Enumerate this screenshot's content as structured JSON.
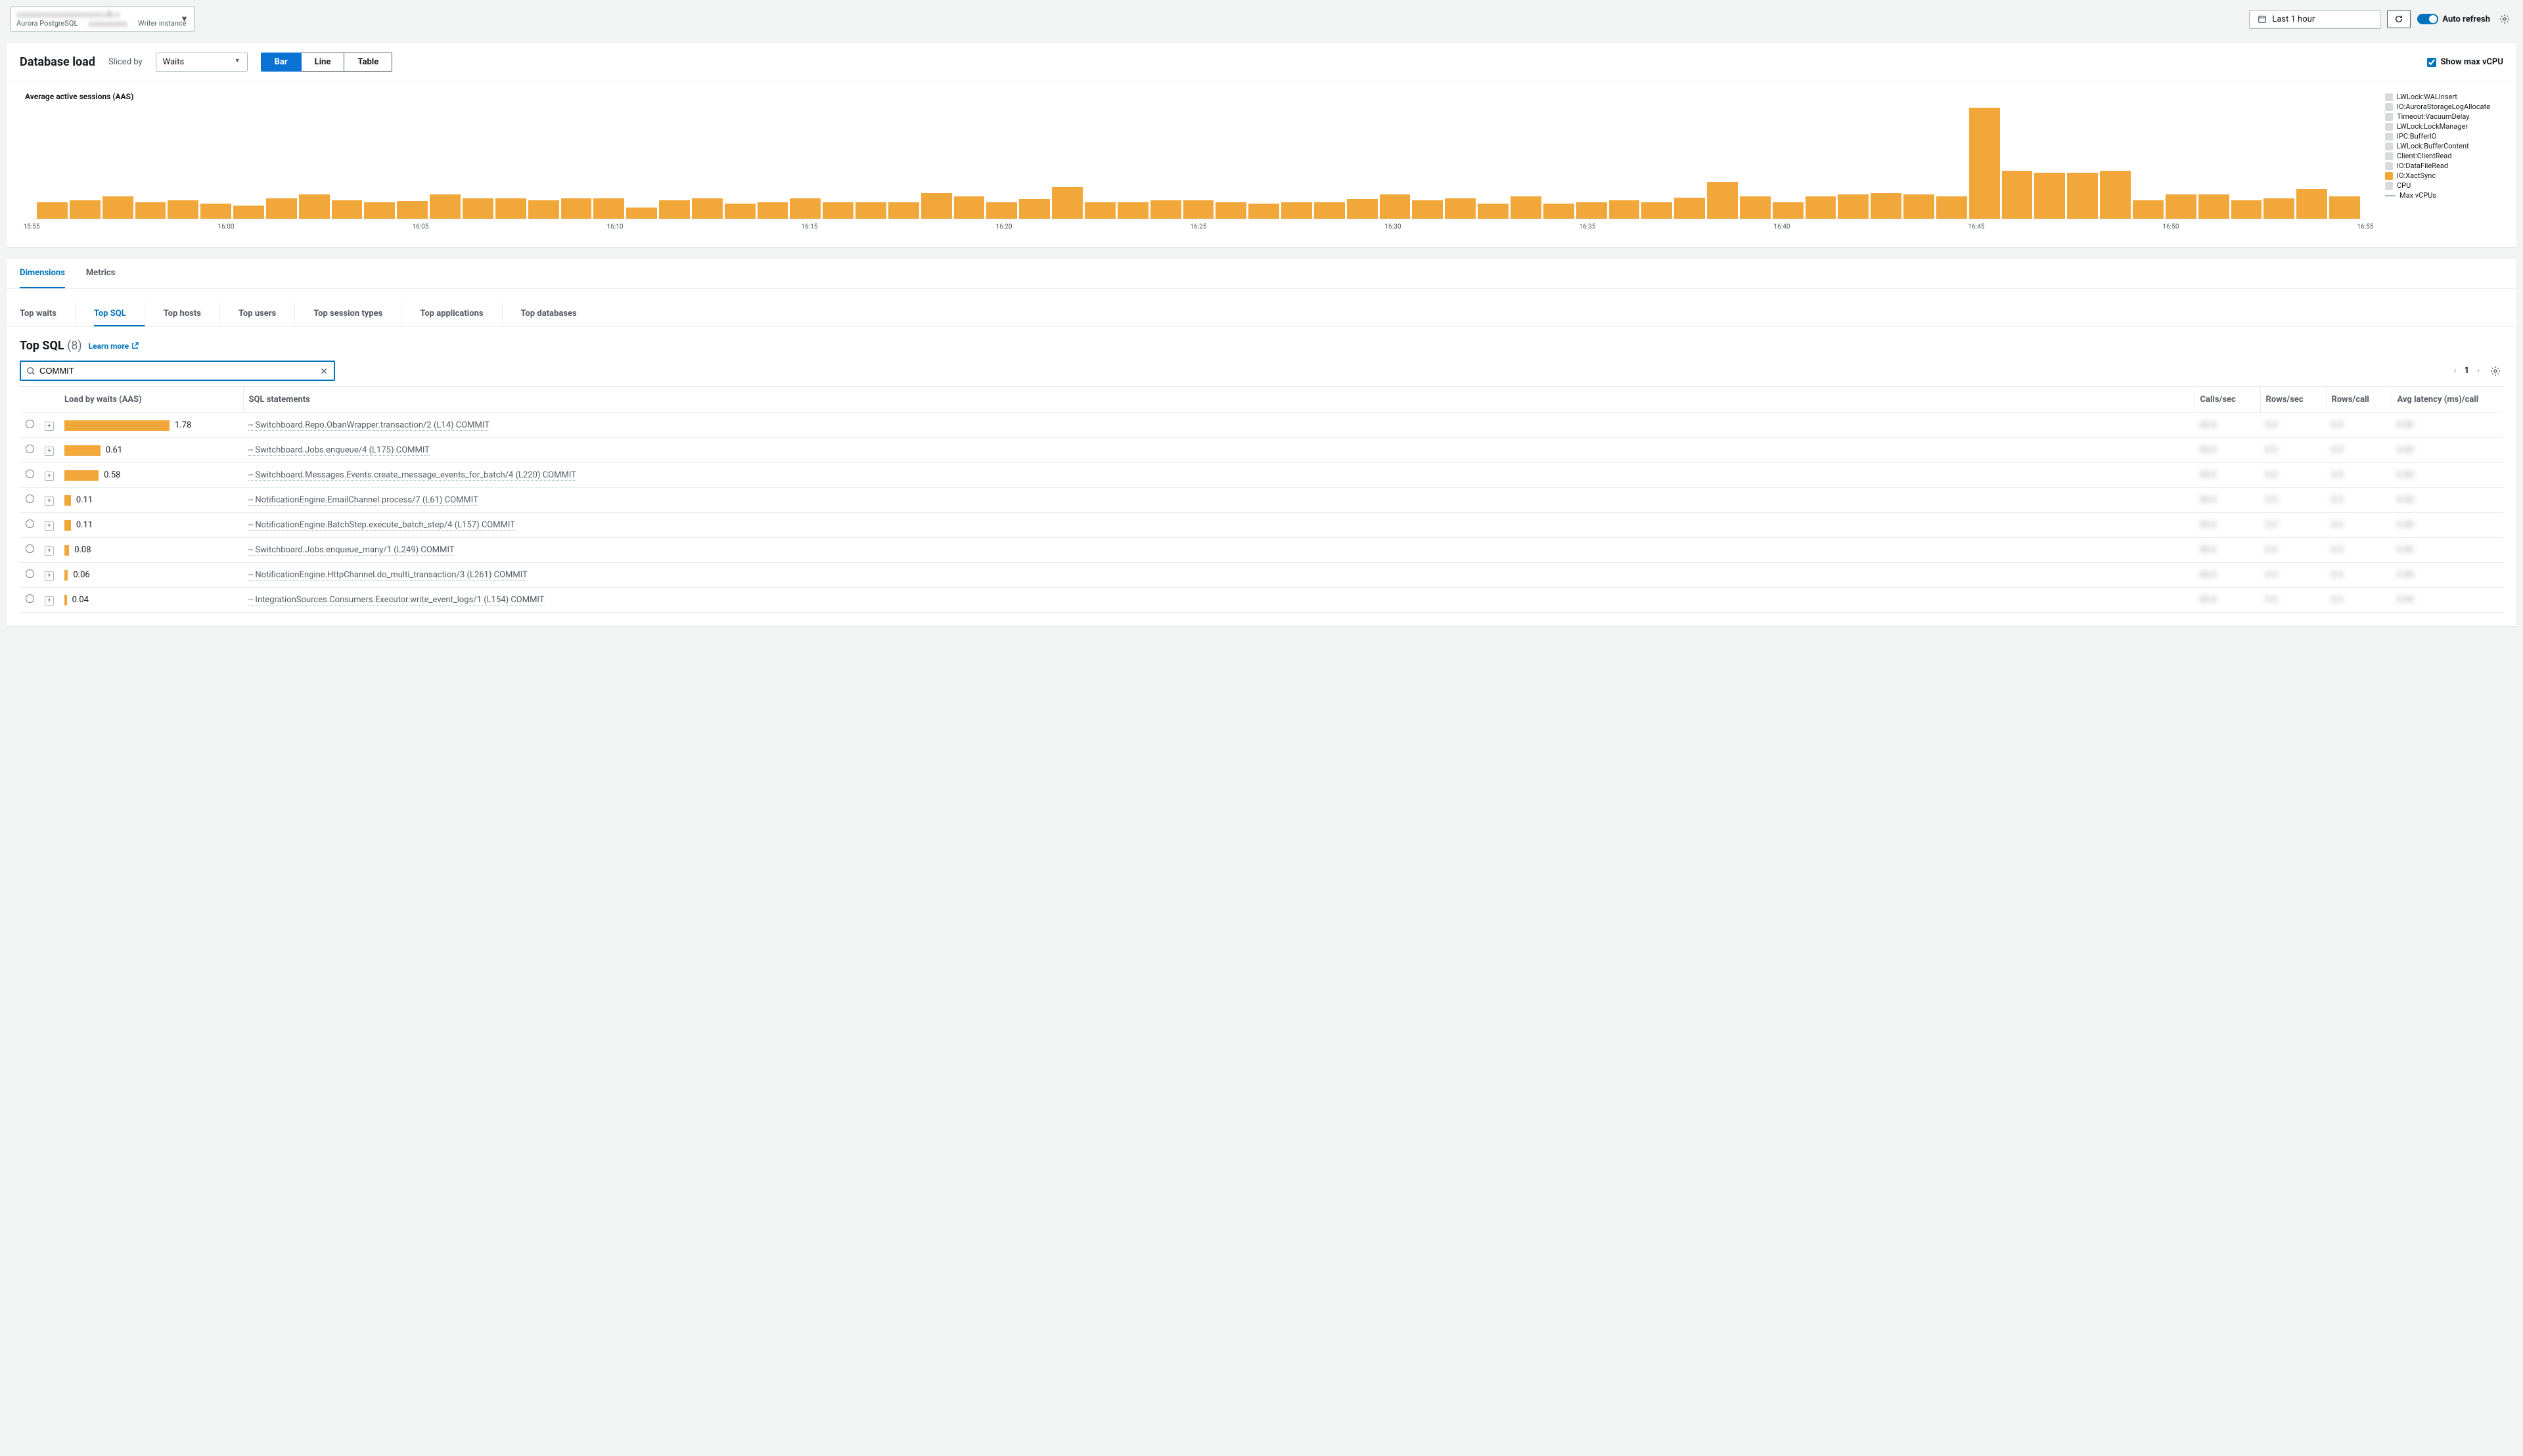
{
  "header": {
    "db_engine": "Aurora PostgreSQL",
    "instance_role": "Writer instance",
    "time_range": "Last 1 hour",
    "auto_refresh_label": "Auto refresh"
  },
  "db_load_panel": {
    "title": "Database load",
    "sliced_by_label": "Sliced by",
    "sliced_by_value": "Waits",
    "view_modes": {
      "bar": "Bar",
      "line": "Line",
      "table": "Table"
    },
    "show_max_label": "Show max vCPU",
    "chart_subtitle": "Average active sessions (AAS)",
    "legend": [
      {
        "label": "LWLock:WALInsert",
        "color": "#d6dbdb"
      },
      {
        "label": "IO:AuroraStorageLogAllocate",
        "color": "#d6dbdb"
      },
      {
        "label": "Timeout:VacuumDelay",
        "color": "#d6dbdb"
      },
      {
        "label": "LWLock:LockManager",
        "color": "#d6dbdb"
      },
      {
        "label": "IPC:BufferIO",
        "color": "#d6dbdb"
      },
      {
        "label": "LWLock:BufferContent",
        "color": "#d6dbdb"
      },
      {
        "label": "Client:ClientRead",
        "color": "#d6dbdb"
      },
      {
        "label": "IO:DataFileRead",
        "color": "#d6dbdb"
      },
      {
        "label": "IO:XactSync",
        "color": "#f2a73b"
      },
      {
        "label": "CPU",
        "color": "#d6dbdb"
      },
      {
        "label": "Max vCPUs",
        "type": "line"
      }
    ]
  },
  "chart_data": {
    "type": "bar",
    "title": "Average active sessions (AAS)",
    "xlabel": "",
    "ylabel": "Average active sessions (AAS)",
    "ylim": [
      0,
      6
    ],
    "x_ticks": [
      "15:55",
      "16:00",
      "16:05",
      "16:10",
      "16:15",
      "16:20",
      "16:25",
      "16:30",
      "16:35",
      "16:40",
      "16:45",
      "16:50",
      "16:55"
    ],
    "series": [
      {
        "name": "IO:XactSync",
        "color": "#f2a73b",
        "values": [
          0.9,
          1.0,
          1.2,
          0.9,
          1.0,
          0.8,
          0.7,
          1.1,
          1.3,
          1.0,
          0.9,
          0.95,
          1.3,
          1.1,
          1.1,
          1.0,
          1.1,
          1.1,
          0.6,
          1.0,
          1.1,
          0.8,
          0.9,
          1.1,
          0.9,
          0.9,
          0.9,
          1.4,
          1.2,
          0.9,
          1.05,
          1.7,
          0.9,
          0.9,
          1.0,
          1.0,
          0.9,
          0.8,
          0.9,
          0.9,
          1.05,
          1.3,
          1.0,
          1.1,
          0.8,
          1.2,
          0.8,
          0.9,
          1.0,
          0.9,
          1.15,
          2.0,
          1.2,
          0.9,
          1.2,
          1.3,
          1.4,
          1.3,
          1.2,
          6.0,
          2.6,
          2.5,
          2.5,
          2.6,
          1.0,
          1.3,
          1.3,
          1.0,
          1.1,
          1.6,
          1.2
        ]
      }
    ]
  },
  "tabs": {
    "dimensions": "Dimensions",
    "metrics": "Metrics"
  },
  "dim_tabs": [
    "Top waits",
    "Top SQL",
    "Top hosts",
    "Top users",
    "Top session types",
    "Top applications",
    "Top databases"
  ],
  "top_sql": {
    "title": "Top SQL",
    "count": "(8)",
    "learn_more": "Learn more",
    "search_value": "COMMIT",
    "page": "1",
    "columns": {
      "load": "Load by waits (AAS)",
      "sql": "SQL statements",
      "calls": "Calls/sec",
      "rows_sec": "Rows/sec",
      "rows_call": "Rows/call",
      "latency": "Avg latency (ms)/call"
    },
    "rows": [
      {
        "load": 1.78,
        "sql": "-- Switchboard.Repo.ObanWrapper.transaction/2 (L14) COMMIT"
      },
      {
        "load": 0.61,
        "sql": "-- Switchboard.Jobs.enqueue/4 (L175) COMMIT"
      },
      {
        "load": 0.58,
        "sql": "-- Switchboard.Messages.Events.create_message_events_for_batch/4 (L220) COMMIT"
      },
      {
        "load": 0.11,
        "sql": "-- NotificationEngine.EmailChannel.process/7 (L61) COMMIT"
      },
      {
        "load": 0.11,
        "sql": "-- NotificationEngine.BatchStep.execute_batch_step/4 (L157) COMMIT"
      },
      {
        "load": 0.08,
        "sql": "-- Switchboard.Jobs.enqueue_many/1 (L249) COMMIT"
      },
      {
        "load": 0.06,
        "sql": "-- NotificationEngine.HttpChannel.do_multi_transaction/3 (L261) COMMIT"
      },
      {
        "load": 0.04,
        "sql": "-- IntegrationSources.Consumers.Executor.write_event_logs/1 (L154) COMMIT"
      }
    ]
  }
}
